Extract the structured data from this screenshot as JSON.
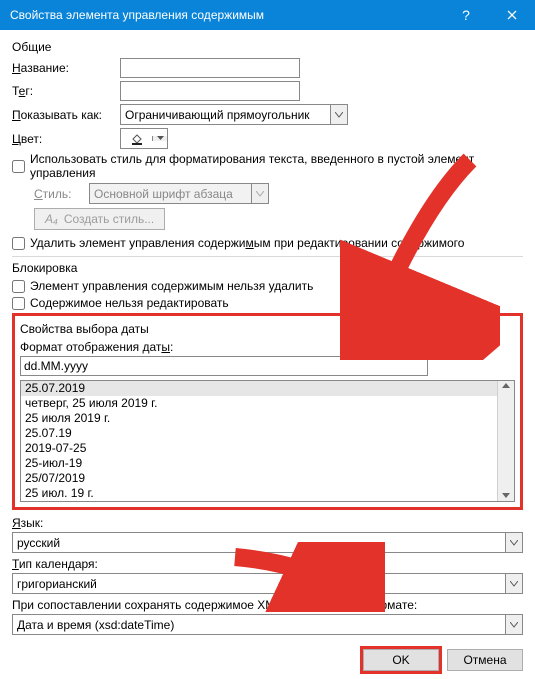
{
  "titlebar": {
    "title": "Свойства элемента управления содержимым"
  },
  "general": {
    "heading": "Общие",
    "name_label": "Название:",
    "name_value": "",
    "tag_label": "Тег:",
    "tag_value": "",
    "display_as_label": "Показывать как:",
    "display_as_value": "Ограничивающий прямоугольник",
    "color_label": "Цвет:",
    "use_style": "Использовать стиль для форматирования текста, введенного в пустой элемент управления",
    "style_label": "Стиль:",
    "style_value": "Основной шрифт абзаца",
    "create_style": "Создать стиль...",
    "remove_on_edit": "Удалить элемент управления содержимым при редактировании содержимого"
  },
  "locking": {
    "heading": "Блокировка",
    "no_delete": "Элемент управления содержимым нельзя удалить",
    "no_edit": "Содержимое нельзя редактировать"
  },
  "date": {
    "heading": "Свойства выбора даты",
    "format_label": "Формат отображения даты:",
    "format_value": "dd.MM.yyyy",
    "samples": [
      "25.07.2019",
      "четверг, 25 июля 2019 г.",
      "25 июля 2019 г.",
      "25.07.19",
      "2019-07-25",
      "25-июл-19",
      "25/07/2019",
      "25 июл. 19 г."
    ],
    "lang_label": "Язык:",
    "lang_value": "русский",
    "cal_label": "Тип календаря:",
    "cal_value": "григорианский",
    "xml_label": "При сопоставлении сохранять содержимое XML в следующем формате:",
    "xml_value": "Дата и время (xsd:dateTime)"
  },
  "footer": {
    "ok": "OK",
    "cancel": "Отмена"
  }
}
